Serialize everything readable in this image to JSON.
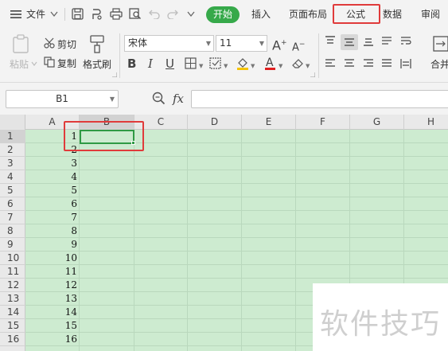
{
  "menubar": {
    "menu_label": "文件",
    "tabs": [
      "开始",
      "插入",
      "页面布局",
      "公式",
      "数据",
      "审阅"
    ],
    "highlighted_tab": "公式",
    "active_tab": "开始",
    "accent_color": "#36a94a",
    "highlight_color": "#e03b3b"
  },
  "ribbon": {
    "paste_label": "粘贴",
    "cut_label": "剪切",
    "copy_label": "复制",
    "format_painter_label": "格式刷",
    "font_name": "宋体",
    "font_size": "11",
    "bold_glyph": "B",
    "italic_glyph": "I",
    "underline_glyph": "U",
    "merge_label": "合并"
  },
  "formula_bar": {
    "name_box": "B1",
    "fx_label": "fx",
    "formula_value": ""
  },
  "sheet": {
    "columns": [
      "A",
      "B",
      "C",
      "D",
      "E",
      "F",
      "G",
      "H"
    ],
    "rows": [
      "1",
      "2",
      "3",
      "4",
      "5",
      "6",
      "7",
      "8",
      "9",
      "10",
      "11",
      "12",
      "13",
      "14",
      "15",
      "16"
    ],
    "column_a_values": [
      "1",
      "2",
      "3",
      "4",
      "5",
      "6",
      "7",
      "8",
      "9",
      "10",
      "11",
      "12",
      "13",
      "14",
      "15",
      "16"
    ],
    "selected_cell": "B1",
    "cell_background": "#cdebd0"
  },
  "watermark": {
    "text": "软件技巧"
  }
}
